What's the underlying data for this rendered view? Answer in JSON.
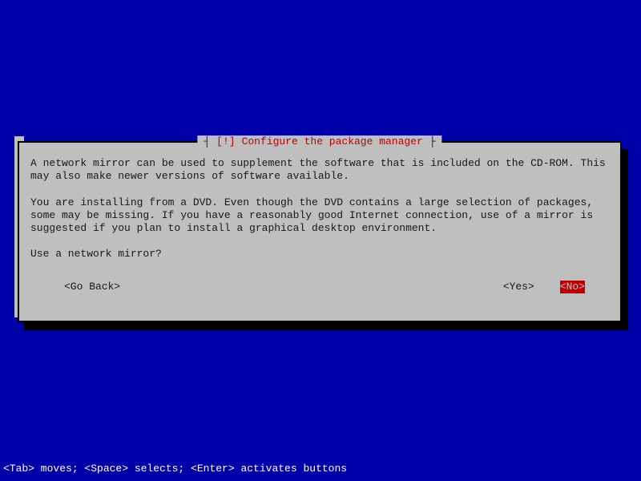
{
  "dialog": {
    "title": "Configure the package manager",
    "tag": "[!]",
    "paragraph1": "A network mirror can be used to supplement the software that is included on the CD-ROM. This may also make newer versions of software available.",
    "paragraph2": "You are installing from a DVD. Even though the DVD contains a large selection of packages, some may be missing. If you have a reasonably good Internet connection, use of a mirror is suggested if you plan to install a graphical desktop environment.",
    "question": "Use a network mirror?",
    "buttons": {
      "go_back": "<Go Back>",
      "yes": "<Yes>",
      "no": "<No>"
    }
  },
  "status_bar": "<Tab> moves; <Space> selects; <Enter> activates buttons"
}
